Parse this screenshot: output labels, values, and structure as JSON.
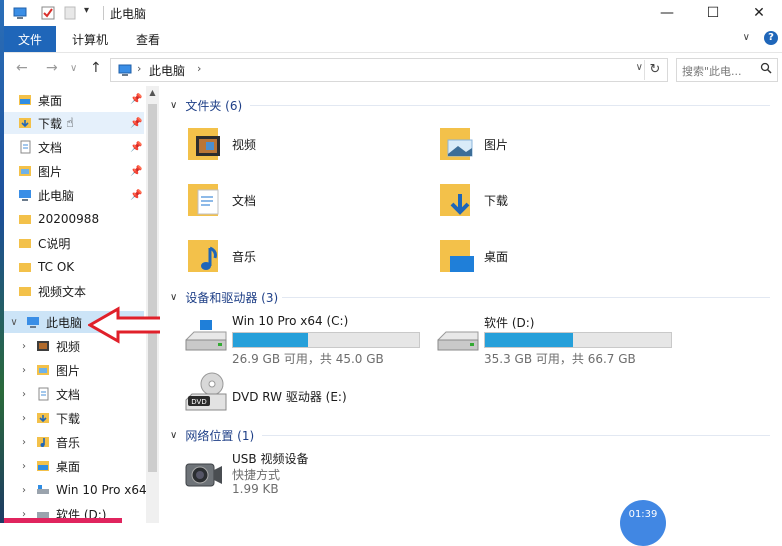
{
  "window": {
    "title": "此电脑",
    "controls": {
      "minimize": "—",
      "maximize": "☐",
      "close": "✕"
    }
  },
  "ribbon": {
    "file_tab": "文件",
    "tabs": [
      "计算机",
      "查看"
    ],
    "expand": "∨",
    "help": "?"
  },
  "address_bar": {
    "back": "←",
    "forward": "→",
    "recent": "∨",
    "up": "↑",
    "path": "此电脑",
    "chevron": "›",
    "dropdown": "∨",
    "refresh": "↻"
  },
  "search": {
    "placeholder": "搜索\"此电...",
    "icon": "search-icon"
  },
  "nav_pane": {
    "items": [
      {
        "label": "桌面",
        "icon": "desktop-folder-icon",
        "pinned": true
      },
      {
        "label": "下载",
        "icon": "download-folder-icon",
        "pinned": true,
        "hovered": true
      },
      {
        "label": "文档",
        "icon": "documents-icon",
        "pinned": true
      },
      {
        "label": "图片",
        "icon": "pictures-icon",
        "pinned": true
      },
      {
        "label": "此电脑",
        "icon": "computer-icon",
        "pinned": true
      },
      {
        "label": "20200988",
        "icon": "folder-icon"
      },
      {
        "label": "C说明",
        "icon": "folder-icon"
      },
      {
        "label": "TC OK",
        "icon": "folder-icon"
      },
      {
        "label": "视频文本",
        "icon": "folder-icon"
      }
    ],
    "this_pc": {
      "label": "此电脑",
      "expanded": true,
      "selected": true
    },
    "children": [
      {
        "label": "视频",
        "icon": "videos-icon"
      },
      {
        "label": "图片",
        "icon": "pictures-icon"
      },
      {
        "label": "文档",
        "icon": "documents-icon"
      },
      {
        "label": "下载",
        "icon": "download-folder-icon"
      },
      {
        "label": "音乐",
        "icon": "music-icon"
      },
      {
        "label": "桌面",
        "icon": "desktop-folder-icon"
      },
      {
        "label": "Win 10 Pro x64",
        "icon": "windows-drive-icon"
      },
      {
        "label": "软件 (D:)",
        "icon": "drive-icon"
      }
    ]
  },
  "content": {
    "folders_group": "文件夹 (6)",
    "folders": [
      {
        "name": "视频",
        "icon": "videos-folder-icon"
      },
      {
        "name": "图片",
        "icon": "pictures-folder-icon"
      },
      {
        "name": "文档",
        "icon": "documents-folder-icon"
      },
      {
        "name": "下载",
        "icon": "download-folder-icon"
      },
      {
        "name": "音乐",
        "icon": "music-folder-icon"
      },
      {
        "name": "桌面",
        "icon": "desktop-folder-icon"
      }
    ],
    "devices_group": "设备和驱动器 (3)",
    "drives": [
      {
        "name": "Win 10 Pro x64 (C:)",
        "free_text": "26.9 GB 可用，共 45.0 GB",
        "used_fraction": 0.402
      },
      {
        "name": "软件 (D:)",
        "free_text": "35.3 GB 可用，共 66.7 GB",
        "used_fraction": 0.471
      }
    ],
    "dvd": {
      "name": "DVD RW 驱动器 (E:)",
      "badge": "DVD"
    },
    "network_group": "网络位置 (1)",
    "network": {
      "name": "USB 视频设备",
      "type": "快捷方式",
      "size": "1.99 KB"
    }
  },
  "overlay": {
    "badge": "01:39"
  },
  "colors": {
    "accent": "#1f66b9",
    "drive_fill": "#26a0da",
    "arrow": "#e0202a",
    "group_text": "#1e3f87"
  }
}
